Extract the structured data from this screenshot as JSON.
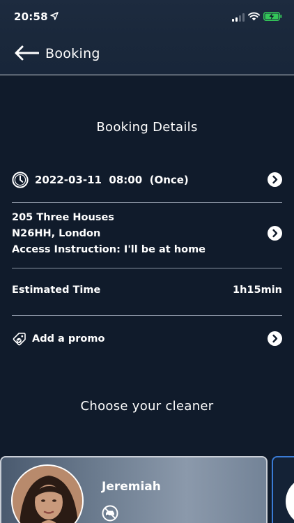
{
  "status_bar": {
    "time": "20:58",
    "icons": [
      "location-arrow-icon",
      "cellular-signal-icon",
      "wifi-icon",
      "battery-charging-icon"
    ]
  },
  "header": {
    "back_icon": "back-arrow-icon",
    "title": "Booking"
  },
  "booking_details": {
    "title": "Booking Details",
    "datetime": "2022-03-11  08:00  (Once)",
    "address_line1": "205 Three Houses",
    "address_line2": "N26HH, London",
    "access_instruction": "Access Instruction: I'll be at home",
    "estimated_time_label": "Estimated Time",
    "estimated_time_value": "1h15min",
    "promo_label": "Add a promo"
  },
  "cleaners": {
    "title": "Choose your cleaner",
    "items": [
      {
        "name": "Jeremiah",
        "badge_icon": "no-car-icon"
      }
    ]
  },
  "colors": {
    "background": "#101b2b",
    "header": "#1a283b",
    "battery_green": "#34c759",
    "selected_card_border": "#3a7bd5"
  }
}
